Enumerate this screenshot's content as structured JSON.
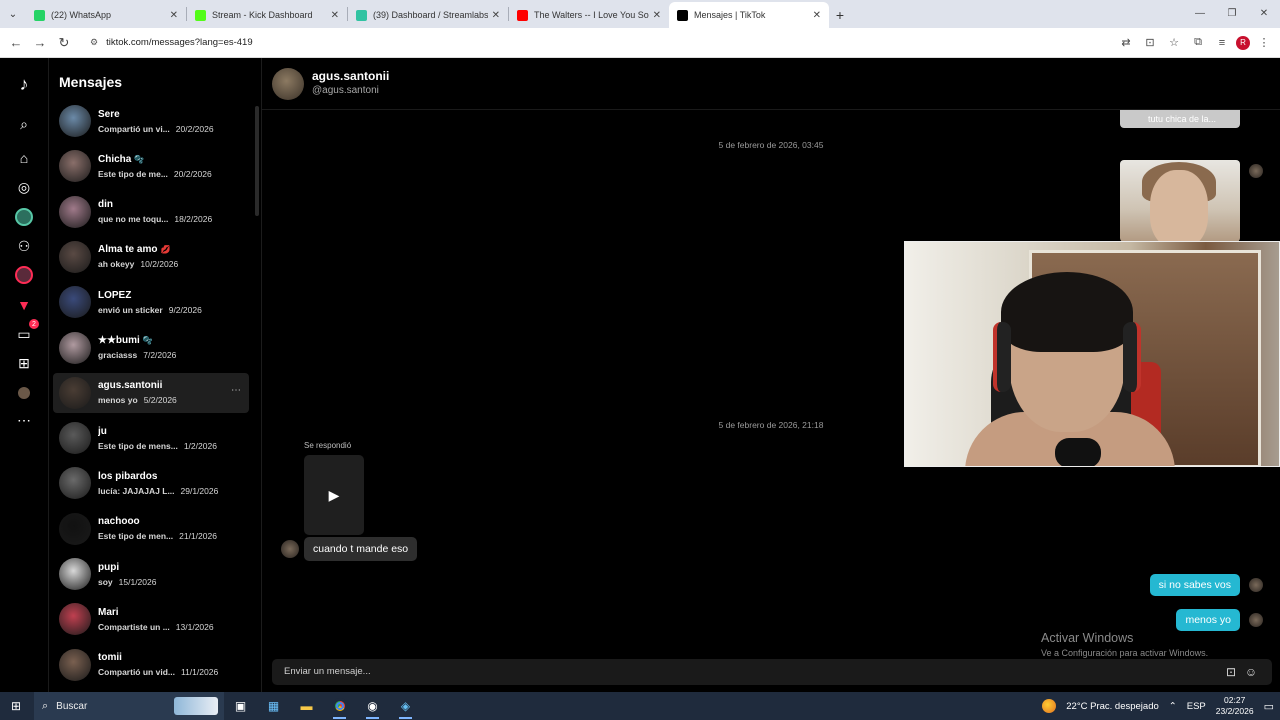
{
  "browser": {
    "tabs": [
      {
        "title": "(22) WhatsApp",
        "color": "#25d366",
        "active": false
      },
      {
        "title": "Stream - Kick Dashboard",
        "color": "#53fc18",
        "active": false
      },
      {
        "title": "(39) Dashboard / Streamlabs",
        "color": "#31c3a2",
        "active": false
      },
      {
        "title": "The Walters -- I Love You So - Y",
        "color": "#ff0000",
        "active": false
      },
      {
        "title": "Mensajes | TikTok",
        "color": "#000000",
        "active": true
      }
    ],
    "url": "tiktok.com/messages?lang=es-419",
    "profile_initial": "R"
  },
  "sidebar": {
    "title": "Mensajes",
    "conversations": [
      {
        "name": "Sere",
        "preview": "Compartió un vi...",
        "date": "20/2/2026"
      },
      {
        "name": "Chicha",
        "emoji": "🫧",
        "preview": "Este tipo de me...",
        "date": "20/2/2026"
      },
      {
        "name": "din",
        "preview": "que no me toqu...",
        "date": "18/2/2026"
      },
      {
        "name": "Alma te amo",
        "emoji": "💋",
        "preview": "ah okeyy",
        "date": "10/2/2026"
      },
      {
        "name": "LOPEZ",
        "preview": "envió un sticker",
        "date": "9/2/2026"
      },
      {
        "name": "★★bumi",
        "emoji": "🫧",
        "preview": "graciasss",
        "date": "7/2/2026"
      },
      {
        "name": "agus.santonii",
        "preview": "menos yo",
        "date": "5/2/2026",
        "selected": true
      },
      {
        "name": "ju",
        "preview": "Este tipo de mens...",
        "date": "1/2/2026"
      },
      {
        "name": "los pibardos",
        "preview": "lucía: JAJAJAJ L...",
        "date": "29/1/2026"
      },
      {
        "name": "nachooo",
        "preview": "Este tipo de men...",
        "date": "21/1/2026"
      },
      {
        "name": "pupi",
        "preview": "soy",
        "date": "15/1/2026"
      },
      {
        "name": "Mari",
        "preview": "Compartiste un ...",
        "date": "13/1/2026"
      },
      {
        "name": "tomii",
        "preview": "Compartió un vid...",
        "date": "11/1/2026"
      }
    ]
  },
  "chat": {
    "name": "agus.santonii",
    "handle": "@agus.santoni",
    "shared_card_text": "tutu chica de la...",
    "date_1": "5 de febrero de 2026, 03:45",
    "date_2": "5 de febrero de 2026, 21:18",
    "replied_label": "Se respondió",
    "incoming_message": "cuando t mande eso",
    "outgoing_1": "si no sabes vos",
    "outgoing_2": "menos yo",
    "composer_placeholder": "Enviar un mensaje..."
  },
  "watermark": {
    "line1": "Activar Windows",
    "line2": "Ve a Configuración para activar Windows."
  },
  "taskbar": {
    "search_placeholder": "Buscar",
    "weather": "22°C  Prac. despejado",
    "language": "ESP",
    "time": "02:27",
    "date": "23/2/2026"
  }
}
